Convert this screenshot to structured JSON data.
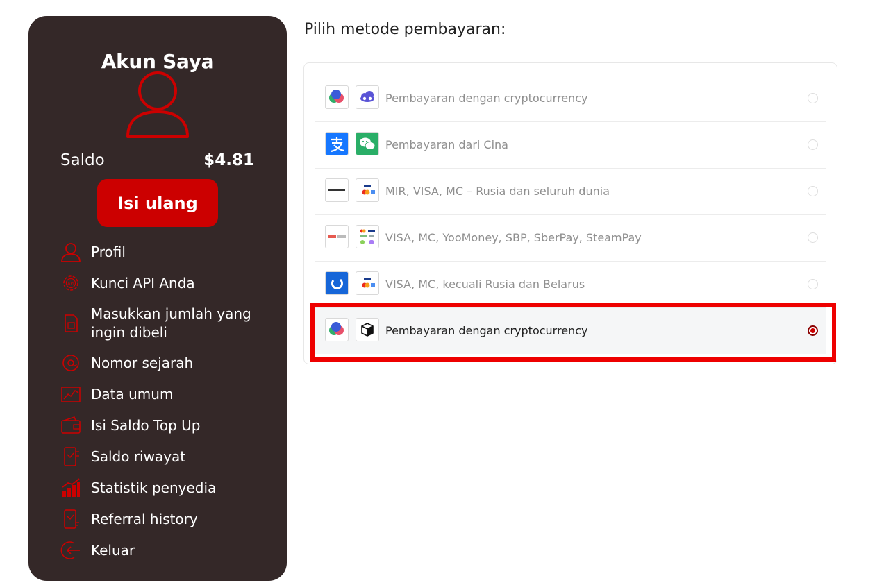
{
  "sidebar": {
    "title": "Akun Saya",
    "balance_label": "Saldo",
    "balance_value": "$4.81",
    "topup_button": "Isi ulang",
    "menu": [
      {
        "label": "Profil",
        "icon": "user-icon"
      },
      {
        "label": "Kunci API Anda",
        "icon": "api-gear-icon"
      },
      {
        "label": "Masukkan jumlah yang ingin dibeli",
        "icon": "sim-card-icon"
      },
      {
        "label": "Nomor sejarah",
        "icon": "at-sign-icon"
      },
      {
        "label": "Data umum",
        "icon": "line-chart-icon"
      },
      {
        "label": "Isi Saldo Top Up",
        "icon": "wallet-icon"
      },
      {
        "label": "Saldo riwayat",
        "icon": "phone-history-icon"
      },
      {
        "label": "Statistik penyedia",
        "icon": "bar-chart-icon"
      },
      {
        "label": "Referral history",
        "icon": "phone-referral-icon"
      },
      {
        "label": "Keluar",
        "icon": "logout-icon"
      }
    ]
  },
  "main": {
    "title": "Pilih metode pembayaran:",
    "methods": [
      {
        "label": "Pembayaran dengan cryptocurrency",
        "logos": [
          "crypto-coins-logo",
          "cloud-crypto-logo"
        ],
        "selected": false
      },
      {
        "label": "Pembayaran dari Cina",
        "logos": [
          "alipay-logo",
          "wechat-pay-logo"
        ],
        "selected": false
      },
      {
        "label": "MIR, VISA, MC – Rusia dan seluruh dunia",
        "logos": [
          "merchant-logo",
          "visa-mastercard-logo"
        ],
        "selected": false
      },
      {
        "label": "VISA, MC, YooMoney, SBP, SberPay, SteamPay",
        "logos": [
          "freekassa-logo",
          "multi-payment-logo"
        ],
        "selected": false
      },
      {
        "label": "VISA, MC, kecuali Rusia dan Belarus",
        "logos": [
          "blue-gateway-logo",
          "visa-mastercard-logo"
        ],
        "selected": false
      },
      {
        "label": "Pembayaran dengan cryptocurrency",
        "logos": [
          "crypto-coins-logo",
          "cube-crypto-logo"
        ],
        "selected": true
      }
    ]
  },
  "colors": {
    "sidebar_bg": "#342828",
    "accent_red": "#cc0000",
    "highlight_border": "#ee0000"
  }
}
